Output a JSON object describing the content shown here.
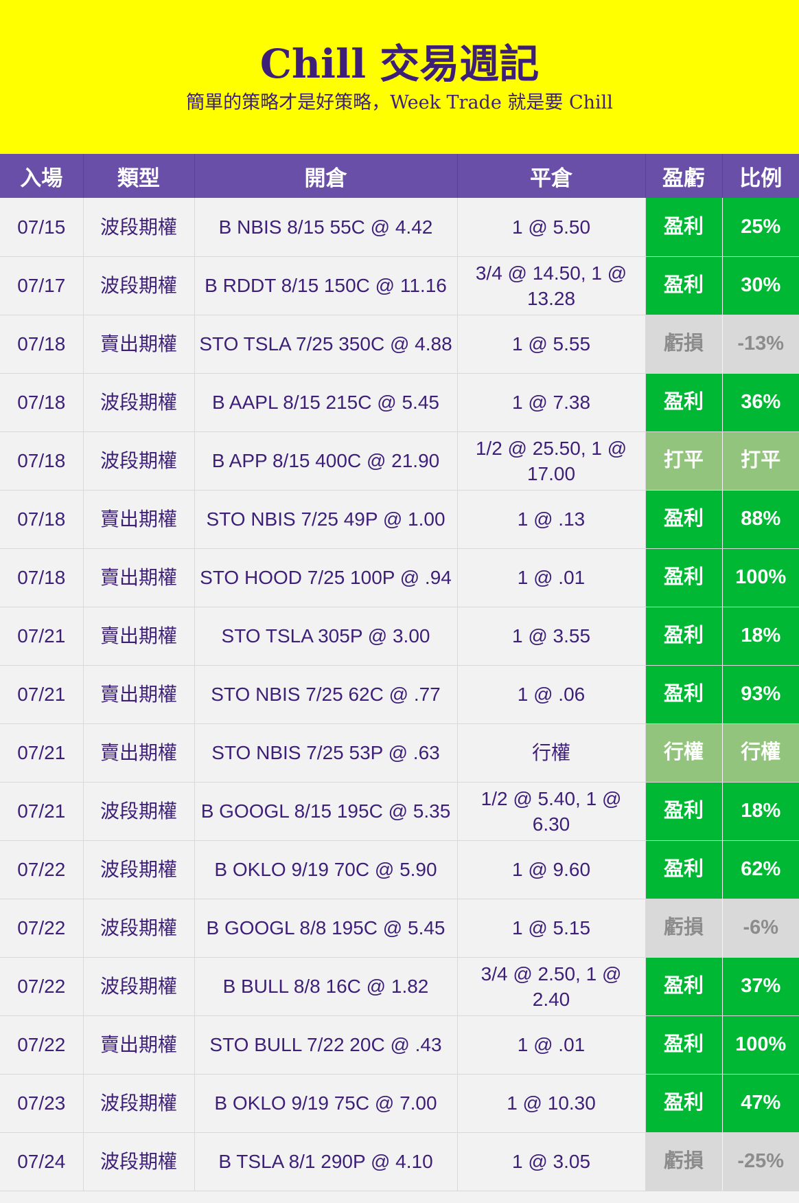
{
  "header": {
    "title": "Chill 交易週記",
    "subtitle": "簡單的策略才是好策略，Week Trade 就是要 Chill"
  },
  "table": {
    "columns": [
      "入場",
      "類型",
      "開倉",
      "平倉",
      "盈虧",
      "比例"
    ],
    "rows": [
      {
        "date": "07/15",
        "type": "波段期權",
        "open": "B NBIS 8/15 55C @ 4.42",
        "close": "1 @ 5.50",
        "pl": "盈利",
        "ratio": "25%",
        "status": "profit"
      },
      {
        "date": "07/17",
        "type": "波段期權",
        "open": "B RDDT 8/15 150C @ 11.16",
        "close": "3/4 @ 14.50, 1 @ 13.28",
        "pl": "盈利",
        "ratio": "30%",
        "status": "profit"
      },
      {
        "date": "07/18",
        "type": "賣出期權",
        "open": "STO TSLA 7/25 350C @ 4.88",
        "close": "1 @ 5.55",
        "pl": "虧損",
        "ratio": "-13%",
        "status": "loss"
      },
      {
        "date": "07/18",
        "type": "波段期權",
        "open": "B AAPL 8/15 215C @ 5.45",
        "close": "1 @ 7.38",
        "pl": "盈利",
        "ratio": "36%",
        "status": "profit"
      },
      {
        "date": "07/18",
        "type": "波段期權",
        "open": "B APP 8/15 400C @ 21.90",
        "close": "1/2 @ 25.50, 1 @ 17.00",
        "pl": "打平",
        "ratio": "打平",
        "status": "even"
      },
      {
        "date": "07/18",
        "type": "賣出期權",
        "open": "STO NBIS 7/25 49P @ 1.00",
        "close": "1 @ .13",
        "pl": "盈利",
        "ratio": "88%",
        "status": "profit"
      },
      {
        "date": "07/18",
        "type": "賣出期權",
        "open": "STO HOOD 7/25 100P @ .94",
        "close": "1 @ .01",
        "pl": "盈利",
        "ratio": "100%",
        "status": "profit"
      },
      {
        "date": "07/21",
        "type": "賣出期權",
        "open": "STO TSLA 305P @ 3.00",
        "close": "1 @ 3.55",
        "pl": "盈利",
        "ratio": "18%",
        "status": "profit"
      },
      {
        "date": "07/21",
        "type": "賣出期權",
        "open": "STO NBIS 7/25 62C @ .77",
        "close": "1 @ .06",
        "pl": "盈利",
        "ratio": "93%",
        "status": "profit"
      },
      {
        "date": "07/21",
        "type": "賣出期權",
        "open": "STO NBIS 7/25 53P @ .63",
        "close": "行權",
        "pl": "行權",
        "ratio": "行權",
        "status": "even"
      },
      {
        "date": "07/21",
        "type": "波段期權",
        "open": "B GOOGL 8/15 195C @ 5.35",
        "close": "1/2 @ 5.40, 1 @ 6.30",
        "pl": "盈利",
        "ratio": "18%",
        "status": "profit"
      },
      {
        "date": "07/22",
        "type": "波段期權",
        "open": "B OKLO 9/19 70C @ 5.90",
        "close": "1 @ 9.60",
        "pl": "盈利",
        "ratio": "62%",
        "status": "profit"
      },
      {
        "date": "07/22",
        "type": "波段期權",
        "open": "B GOOGL 8/8 195C @ 5.45",
        "close": "1 @ 5.15",
        "pl": "虧損",
        "ratio": "-6%",
        "status": "loss"
      },
      {
        "date": "07/22",
        "type": "波段期權",
        "open": "B BULL 8/8 16C @ 1.82",
        "close": "3/4 @ 2.50, 1 @ 2.40",
        "pl": "盈利",
        "ratio": "37%",
        "status": "profit"
      },
      {
        "date": "07/22",
        "type": "賣出期權",
        "open": "STO BULL 7/22 20C @ .43",
        "close": "1 @ .01",
        "pl": "盈利",
        "ratio": "100%",
        "status": "profit"
      },
      {
        "date": "07/23",
        "type": "波段期權",
        "open": "B OKLO 9/19 75C @ 7.00",
        "close": "1 @ 10.30",
        "pl": "盈利",
        "ratio": "47%",
        "status": "profit"
      },
      {
        "date": "07/24",
        "type": "波段期權",
        "open": "B TSLA 8/1 290P @ 4.10",
        "close": "1 @ 3.05",
        "pl": "虧損",
        "ratio": "-25%",
        "status": "loss"
      }
    ]
  },
  "colors": {
    "banner_bg": "#ffff00",
    "header_bg": "#6a4fa8",
    "text": "#3d1f78",
    "profit": "#00b833",
    "loss": "#d9d9d9",
    "even": "#93c47d"
  }
}
